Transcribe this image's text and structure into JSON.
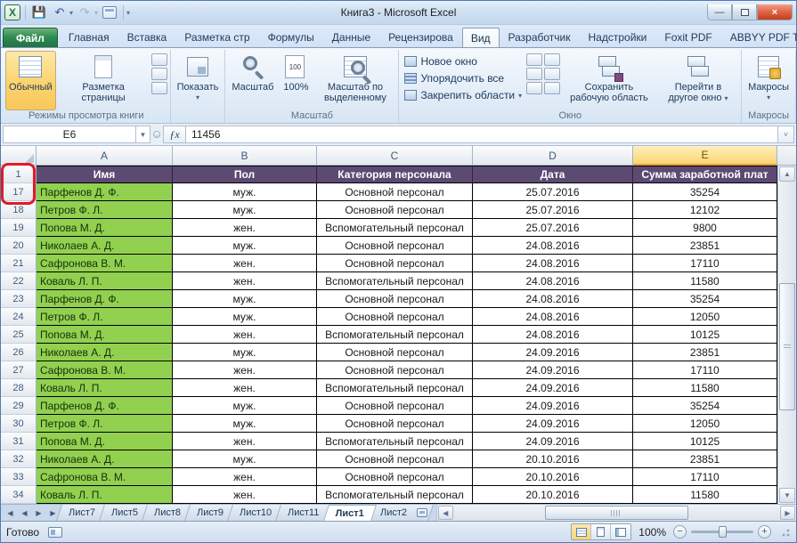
{
  "title": "Книга3  -  Microsoft Excel",
  "icons": {
    "dropdown": "▾",
    "undo": "↶",
    "redo": "↷",
    "chevron_up": "˄",
    "help": "?",
    "minimize": "—",
    "close": "×",
    "up": "▲",
    "down": "▼",
    "left": "◀",
    "right": "▶",
    "fx": "ƒx",
    "minus": "−",
    "plus": "+",
    "formula_expand": "˅",
    "name_arrow": "▼"
  },
  "ribbon_tabs": {
    "file": "Файл",
    "tabs": [
      "Главная",
      "Вставка",
      "Разметка стр",
      "Формулы",
      "Данные",
      "Рецензирова",
      "Вид",
      "Разработчик",
      "Надстройки",
      "Foxit PDF",
      "ABBYY PDF Tra"
    ],
    "active": "Вид"
  },
  "ribbon": {
    "views_group": {
      "normal": "Обычный",
      "page_layout": "Разметка страницы",
      "label": "Режимы просмотра книги"
    },
    "show_group": {
      "show": "Показать"
    },
    "zoom_group": {
      "zoom": "Масштаб",
      "hundred": "100%",
      "zoom_selection": "Масштаб по выделенному",
      "label": "Масштаб"
    },
    "window_group": {
      "new_window": "Новое окно",
      "arrange_all": "Упорядочить все",
      "freeze_panes": "Закрепить области",
      "save_workspace": "Сохранить рабочую область",
      "switch_windows": "Перейти в другое окно",
      "label": "Окно"
    },
    "macros_group": {
      "macros": "Макросы",
      "label": "Макросы"
    }
  },
  "formula_bar": {
    "name_box": "Е6",
    "value": "11456"
  },
  "grid": {
    "columns": [
      "A",
      "B",
      "C",
      "D",
      "E"
    ],
    "selected_column": "E",
    "header_row": {
      "num": "1",
      "cells": [
        "Имя",
        "Пол",
        "Категория персонала",
        "Дата",
        "Сумма заработной плат"
      ]
    },
    "rows": [
      {
        "num": "17",
        "name": "Парфенов Д. Ф.",
        "gender": "муж.",
        "category": "Основной персонал",
        "date": "25.07.2016",
        "sum": "35254"
      },
      {
        "num": "18",
        "name": "Петров Ф. Л.",
        "gender": "муж.",
        "category": "Основной персонал",
        "date": "25.07.2016",
        "sum": "12102"
      },
      {
        "num": "19",
        "name": "Попова М. Д.",
        "gender": "жен.",
        "category": "Вспомогательный персонал",
        "date": "25.07.2016",
        "sum": "9800"
      },
      {
        "num": "20",
        "name": "Николаев А. Д.",
        "gender": "муж.",
        "category": "Основной персонал",
        "date": "24.08.2016",
        "sum": "23851"
      },
      {
        "num": "21",
        "name": "Сафронова В. М.",
        "gender": "жен.",
        "category": "Основной персонал",
        "date": "24.08.2016",
        "sum": "17110"
      },
      {
        "num": "22",
        "name": "Коваль Л. П.",
        "gender": "жен.",
        "category": "Вспомогательный персонал",
        "date": "24.08.2016",
        "sum": "11580"
      },
      {
        "num": "23",
        "name": "Парфенов Д. Ф.",
        "gender": "муж.",
        "category": "Основной персонал",
        "date": "24.08.2016",
        "sum": "35254"
      },
      {
        "num": "24",
        "name": "Петров Ф. Л.",
        "gender": "муж.",
        "category": "Основной персонал",
        "date": "24.08.2016",
        "sum": "12050"
      },
      {
        "num": "25",
        "name": "Попова М. Д.",
        "gender": "жен.",
        "category": "Вспомогательный персонал",
        "date": "24.08.2016",
        "sum": "10125"
      },
      {
        "num": "26",
        "name": "Николаев А. Д.",
        "gender": "муж.",
        "category": "Основной персонал",
        "date": "24.09.2016",
        "sum": "23851"
      },
      {
        "num": "27",
        "name": "Сафронова В. М.",
        "gender": "жен.",
        "category": "Основной персонал",
        "date": "24.09.2016",
        "sum": "17110"
      },
      {
        "num": "28",
        "name": "Коваль Л. П.",
        "gender": "жен.",
        "category": "Вспомогательный персонал",
        "date": "24.09.2016",
        "sum": "11580"
      },
      {
        "num": "29",
        "name": "Парфенов Д. Ф.",
        "gender": "муж.",
        "category": "Основной персонал",
        "date": "24.09.2016",
        "sum": "35254"
      },
      {
        "num": "30",
        "name": "Петров Ф. Л.",
        "gender": "муж.",
        "category": "Основной персонал",
        "date": "24.09.2016",
        "sum": "12050"
      },
      {
        "num": "31",
        "name": "Попова М. Д.",
        "gender": "жен.",
        "category": "Вспомогательный персонал",
        "date": "24.09.2016",
        "sum": "10125"
      },
      {
        "num": "32",
        "name": "Николаев А. Д.",
        "gender": "муж.",
        "category": "Основной персонал",
        "date": "20.10.2016",
        "sum": "23851"
      },
      {
        "num": "33",
        "name": "Сафронова В. М.",
        "gender": "жен.",
        "category": "Основной персонал",
        "date": "20.10.2016",
        "sum": "17110"
      },
      {
        "num": "34",
        "name": "Коваль Л. П.",
        "gender": "жен.",
        "category": "Вспомогательный персонал",
        "date": "20.10.2016",
        "sum": "11580"
      }
    ]
  },
  "sheet_tabs": {
    "tabs": [
      "Лист7",
      "Лист5",
      "Лист8",
      "Лист9",
      "Лист10",
      "Лист11",
      "Лист1",
      "Лист2"
    ],
    "active": "Лист1"
  },
  "status_bar": {
    "ready": "Готово",
    "zoom": "100%"
  },
  "colors": {
    "header_purple": "#5C4A72",
    "row_green": "#92D050",
    "selection_amber": "#FBD671",
    "annotation_red": "#E01B24",
    "file_tab_green": "#1F7244"
  }
}
